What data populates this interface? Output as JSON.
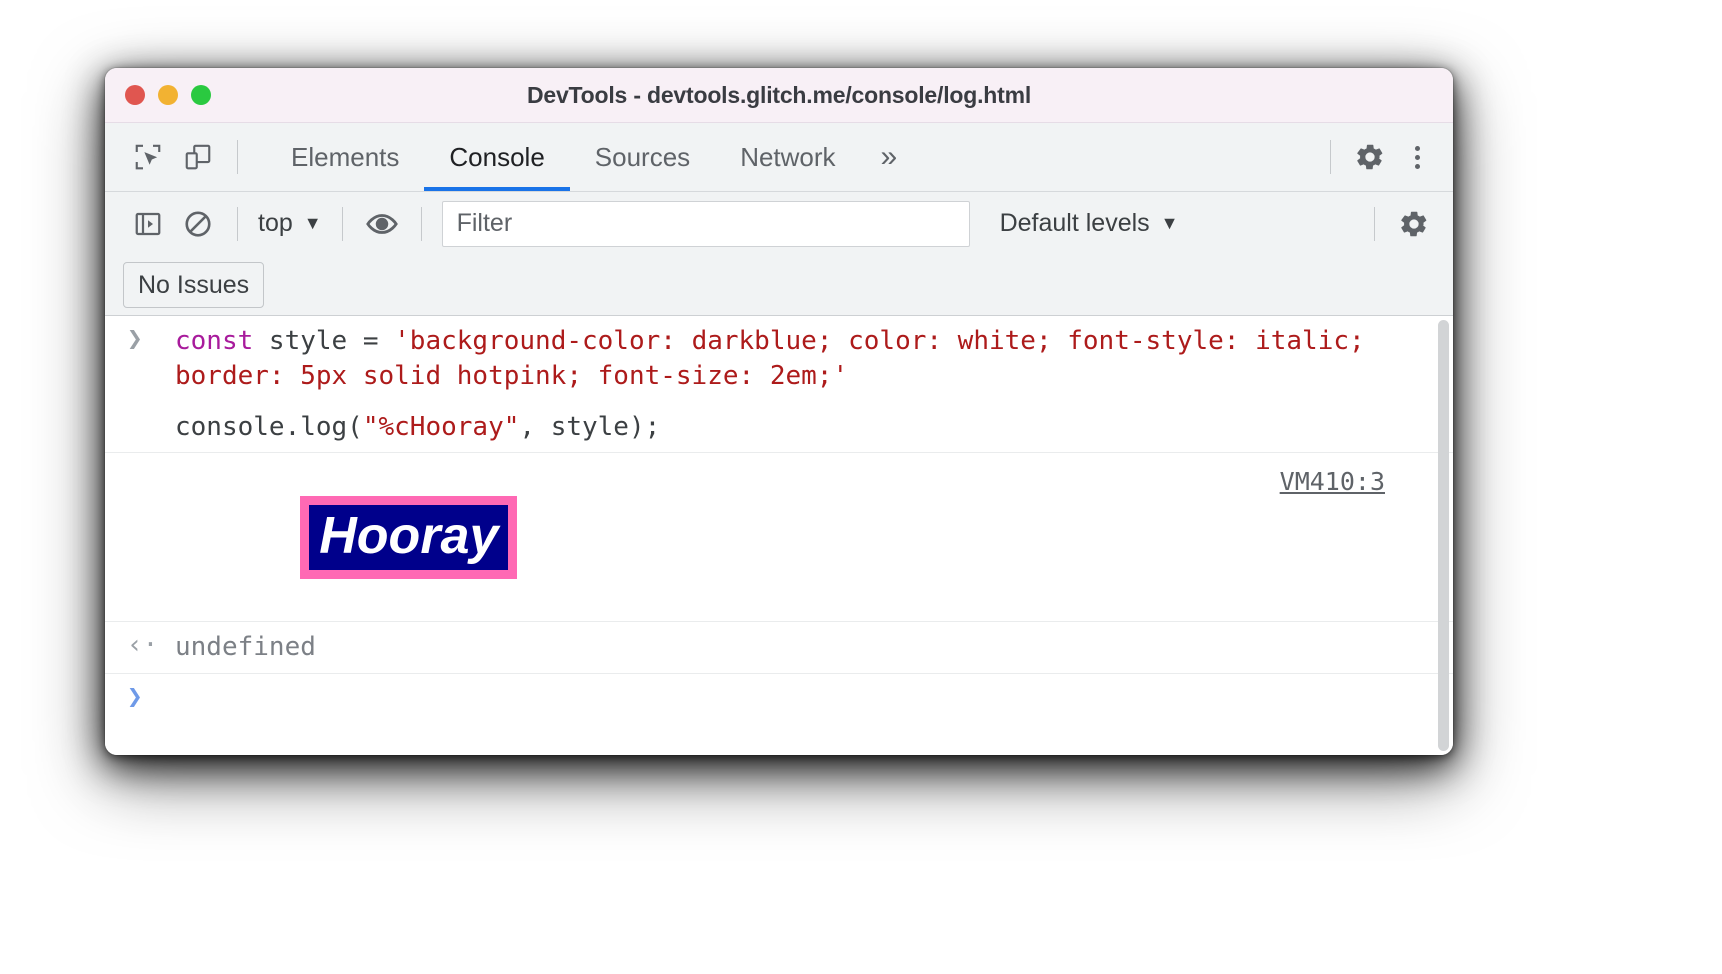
{
  "window": {
    "title": "DevTools - devtools.glitch.me/console/log.html",
    "traffic_lights": [
      {
        "name": "close",
        "color": "#e05650"
      },
      {
        "name": "minimize",
        "color": "#f2b232"
      },
      {
        "name": "maximize",
        "color": "#2ac940"
      }
    ]
  },
  "tabbar": {
    "inspect_icon": "inspect-element-icon",
    "device_icon": "device-toolbar-icon",
    "tabs": [
      {
        "label": "Elements",
        "active": false
      },
      {
        "label": "Console",
        "active": true
      },
      {
        "label": "Sources",
        "active": false
      },
      {
        "label": "Network",
        "active": false
      }
    ],
    "more_tabs": "»",
    "settings_icon": "gear-icon",
    "menu_icon": "kebab-menu-icon",
    "active_tab_underline_color": "#1a73e8"
  },
  "console_toolbar": {
    "sidebar_toggle_icon": "console-sidebar-icon",
    "clear_icon": "clear-console-icon",
    "context": "top",
    "context_caret": "▼",
    "eye_icon": "live-expression-icon",
    "filter_placeholder": "Filter",
    "filter_value": "",
    "levels": "Default levels",
    "levels_caret": "▼",
    "settings_icon": "console-settings-gear-icon"
  },
  "issues": {
    "label": "No Issues"
  },
  "console": {
    "messages": [
      {
        "type": "input",
        "gutter": "❯",
        "tokens": [
          {
            "text": "const ",
            "cls": "tok-kw"
          },
          {
            "text": "style = ",
            "cls": "tok-def"
          },
          {
            "text": "'background-color: darkblue; color: white; font-style: italic; border: 5px solid hotpink; font-size: 2em;'",
            "cls": "tok-str"
          }
        ]
      },
      {
        "type": "input",
        "gutter": "",
        "tokens": [
          {
            "text": "console.log(",
            "cls": "tok-def"
          },
          {
            "text": "\"%cHooray\"",
            "cls": "tok-str"
          },
          {
            "text": ", style);",
            "cls": "tok-def"
          }
        ]
      },
      {
        "type": "styled-output",
        "gutter": "",
        "text": "Hooray",
        "source": "VM410:3",
        "style": {
          "background_color": "#00008b",
          "color": "#ffffff",
          "font_style": "italic",
          "border": "9px solid #ff69b4",
          "font_size": "2em"
        }
      },
      {
        "type": "result",
        "gutter": "‹·",
        "text": "undefined"
      },
      {
        "type": "prompt",
        "gutter": "❯",
        "text": ""
      }
    ]
  }
}
